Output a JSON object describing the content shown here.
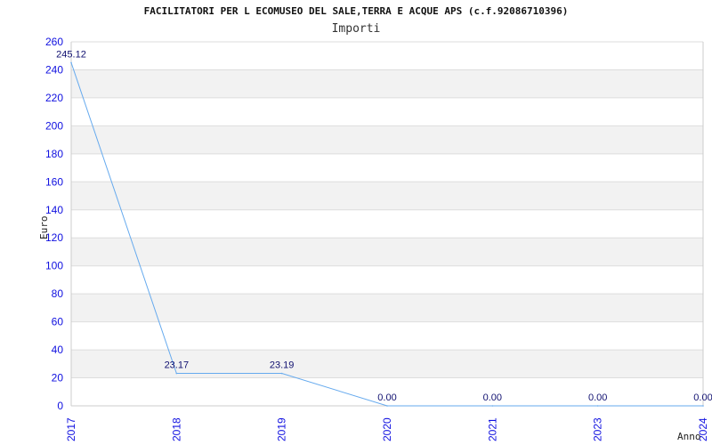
{
  "chart_data": {
    "type": "line",
    "title": "FACILITATORI PER L ECOMUSEO DEL SALE,TERRA E ACQUE APS (c.f.92086710396)",
    "subtitle": "Importi",
    "xlabel": "Anno",
    "ylabel": "Euro",
    "categories": [
      "2017",
      "2018",
      "2019",
      "2020",
      "2021",
      "2023",
      "2024"
    ],
    "values": [
      245.12,
      23.17,
      23.19,
      0.0,
      0.0,
      0.0,
      0.0
    ],
    "data_labels": [
      "245.12",
      "23.17",
      "23.19",
      "0.00",
      "0.00",
      "0.00",
      "0.00"
    ],
    "ylim": [
      0,
      260
    ],
    "yticks": [
      0,
      20,
      40,
      60,
      80,
      100,
      120,
      140,
      160,
      180,
      200,
      220,
      240,
      260
    ],
    "grid": true,
    "line_color": "#66aaee",
    "tick_color": "#1010e0",
    "band_color": "#f2f2f2"
  }
}
